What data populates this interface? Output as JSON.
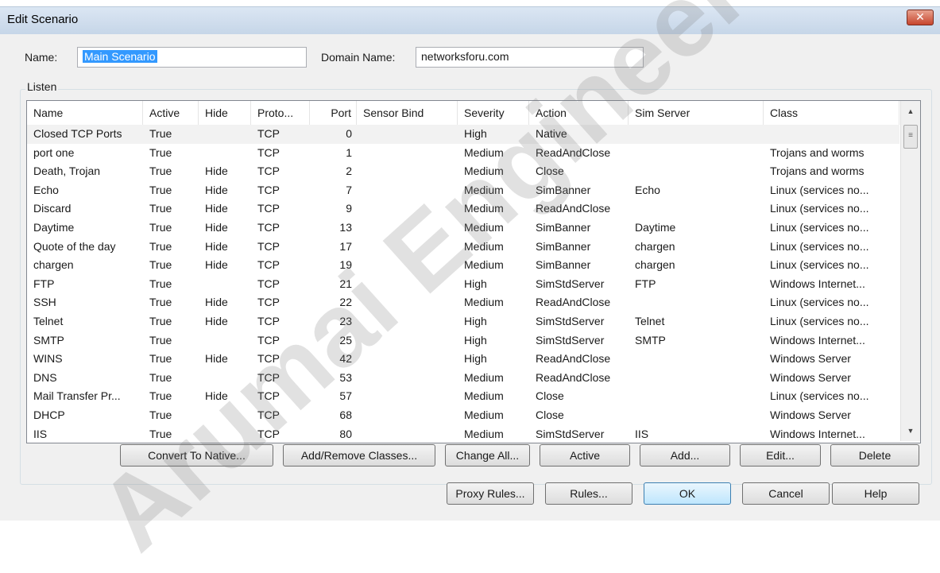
{
  "window": {
    "title": "Edit Scenario",
    "close_glyph": "✕"
  },
  "form": {
    "name_label": "Name:",
    "name_value": "Main Scenario",
    "domain_label": "Domain Name:",
    "domain_value": "networksforu.com",
    "group_label": "Listen"
  },
  "table": {
    "columns": [
      "Name",
      "Active",
      "Hide",
      "Proto...",
      "Port",
      "Sensor Bind",
      "Severity",
      "Action",
      "Sim Server",
      "Class"
    ],
    "rows": [
      [
        "Closed TCP Ports",
        "True",
        "",
        "TCP",
        "0",
        "",
        "High",
        "Native",
        "",
        ""
      ],
      [
        "port one",
        "True",
        "",
        "TCP",
        "1",
        "",
        "Medium",
        "ReadAndClose",
        "",
        "Trojans and worms"
      ],
      [
        "Death, Trojan",
        "True",
        "Hide",
        "TCP",
        "2",
        "",
        "Medium",
        "Close",
        "",
        "Trojans and worms"
      ],
      [
        "Echo",
        "True",
        "Hide",
        "TCP",
        "7",
        "",
        "Medium",
        "SimBanner",
        "Echo",
        "Linux (services no..."
      ],
      [
        "Discard",
        "True",
        "Hide",
        "TCP",
        "9",
        "",
        "Medium",
        "ReadAndClose",
        "",
        "Linux (services no..."
      ],
      [
        "Daytime",
        "True",
        "Hide",
        "TCP",
        "13",
        "",
        "Medium",
        "SimBanner",
        "Daytime",
        "Linux (services no..."
      ],
      [
        "Quote of the day",
        "True",
        "Hide",
        "TCP",
        "17",
        "",
        "Medium",
        "SimBanner",
        "chargen",
        "Linux (services no..."
      ],
      [
        "chargen",
        "True",
        "Hide",
        "TCP",
        "19",
        "",
        "Medium",
        "SimBanner",
        "chargen",
        "Linux (services no..."
      ],
      [
        "FTP",
        "True",
        "",
        "TCP",
        "21",
        "",
        "High",
        "SimStdServer",
        "FTP",
        "Windows Internet..."
      ],
      [
        "SSH",
        "True",
        "Hide",
        "TCP",
        "22",
        "",
        "Medium",
        "ReadAndClose",
        "",
        "Linux (services no..."
      ],
      [
        "Telnet",
        "True",
        "Hide",
        "TCP",
        "23",
        "",
        "High",
        "SimStdServer",
        "Telnet",
        "Linux (services no..."
      ],
      [
        "SMTP",
        "True",
        "",
        "TCP",
        "25",
        "",
        "High",
        "SimStdServer",
        "SMTP",
        "Windows Internet..."
      ],
      [
        "WINS",
        "True",
        "Hide",
        "TCP",
        "42",
        "",
        "High",
        "ReadAndClose",
        "",
        "Windows Server"
      ],
      [
        "DNS",
        "True",
        "",
        "TCP",
        "53",
        "",
        "Medium",
        "ReadAndClose",
        "",
        "Windows Server"
      ],
      [
        "Mail Transfer Pr...",
        "True",
        "Hide",
        "TCP",
        "57",
        "",
        "Medium",
        "Close",
        "",
        "Linux (services no..."
      ],
      [
        "DHCP",
        "True",
        "",
        "TCP",
        "68",
        "",
        "Medium",
        "Close",
        "",
        "Windows Server"
      ],
      [
        "IIS",
        "True",
        "",
        "TCP",
        "80",
        "",
        "Medium",
        "SimStdServer",
        "IIS",
        "Windows Internet..."
      ]
    ]
  },
  "list_buttons": {
    "convert": "Convert To Native...",
    "classes": "Add/Remove Classes...",
    "change_all": "Change All...",
    "active": "Active",
    "add": "Add...",
    "edit": "Edit...",
    "delete": "Delete"
  },
  "dialog_buttons": {
    "proxy_rules": "Proxy Rules...",
    "rules": "Rules...",
    "ok": "OK",
    "cancel": "Cancel",
    "help": "Help"
  },
  "watermark_text": "Arumai Engineer",
  "scrollbar": {
    "up_glyph": "▲",
    "down_glyph": "▼",
    "thumb_glyph": "≡"
  }
}
